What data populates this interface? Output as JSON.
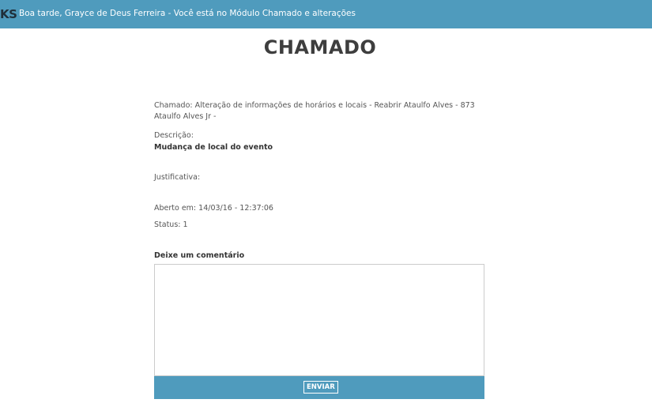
{
  "header": {
    "logo_fragment": "KS",
    "greeting": "Boa tarde, Grayce de Deus Ferreira - Você está no Módulo Chamado e alterações"
  },
  "page": {
    "title": "CHAMADO"
  },
  "ticket": {
    "chamado_label": "Chamado: ",
    "chamado_value": "Alteração de informações de horários e locais - Reabrir Ataulfo Alves - 873 Ataulfo Alves Jr -",
    "descricao_label": "Descrição:",
    "descricao_value": "Mudança de local do evento",
    "justificativa_label": "Justificativa:",
    "aberto_label": "Aberto em: ",
    "aberto_value": "14/03/16 - 12:37:06",
    "status_label": "Status: ",
    "status_value": "1"
  },
  "comment": {
    "label": "Deixe um comentário",
    "value": "",
    "submit_label": "ENVIAR"
  },
  "colors": {
    "accent": "#4f9bbd",
    "title": "#3e3e3e",
    "text": "#555555"
  }
}
